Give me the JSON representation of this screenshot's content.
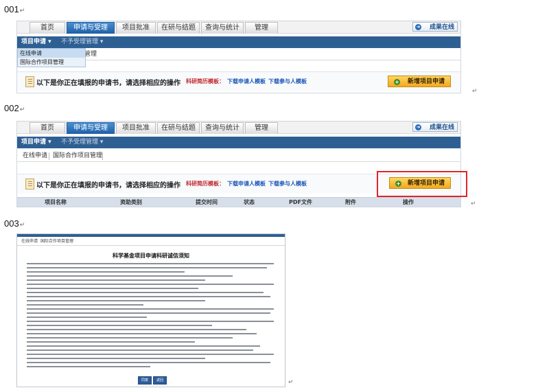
{
  "labels": {
    "step1": "001",
    "step2": "002",
    "step3": "003",
    "return_mark": "↵"
  },
  "tabs": [
    "首页",
    "申请与受理",
    "项目批准",
    "在研与结题",
    "查询与统计",
    "管理"
  ],
  "active_tab": "申请与受理",
  "achievement_button": "成果在线",
  "nav": {
    "apply_menu": "项目申请 ▾",
    "non_accept_menu": "不予受理管理 ▾"
  },
  "dropdown_items": [
    "在线申请",
    "国际合作项目管理"
  ],
  "subnav": {
    "online_apply": "在线申请",
    "intl_coop": "国际合作项目管理",
    "partial": "管理"
  },
  "notice": {
    "message": "以下是你正在填报的申请书，请选择相应的操作",
    "template_label": "科研简历模板：",
    "download_applicant": "下载申请人模板",
    "download_participant": "下载参与人模板"
  },
  "add_button": "新增项目申请",
  "table_headers": [
    "项目名称",
    "资助类别",
    "提交时间",
    "状态",
    "PDF文件",
    "附件",
    "操作"
  ],
  "doc": {
    "subnav_online": "在线申请",
    "subnav_intl": "国际合作项目管理",
    "title": "科学基金项目申请科研诚信须知",
    "btn_agree": "同意",
    "btn_back": "返回"
  },
  "colors": {
    "nav_blue": "#2e5f93",
    "tab_active": "#2b6db8",
    "button_orange": "#f3a81e",
    "highlight_red": "#e0242a",
    "link_blue": "#1a56b8",
    "label_red": "#c0272d"
  }
}
